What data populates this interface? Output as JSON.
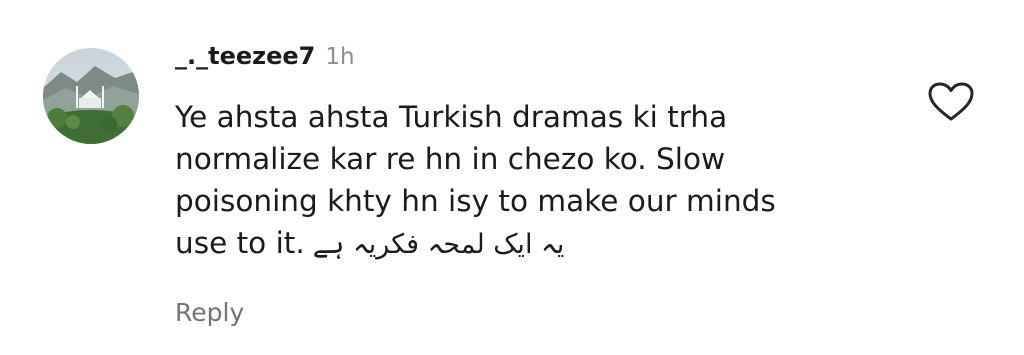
{
  "comment": {
    "username": "_._teezee7",
    "timestamp": "1h",
    "text_lines": [
      "Ye ahsta ahsta Turkish dramas ki trha",
      "normalize kar re hn in chezo ko. Slow",
      "poisoning khty hn isy to make our minds",
      "use to it."
    ],
    "urdu_text": "یہ ایک لمحہ فکریہ ہے",
    "reply_label": "Reply",
    "like_icon": "heart-outline-icon"
  },
  "colors": {
    "text": "#1b1b1b",
    "timestamp": "#8e8e8e",
    "reply": "#737373",
    "icon": "#262626",
    "background": "#ffffff"
  }
}
